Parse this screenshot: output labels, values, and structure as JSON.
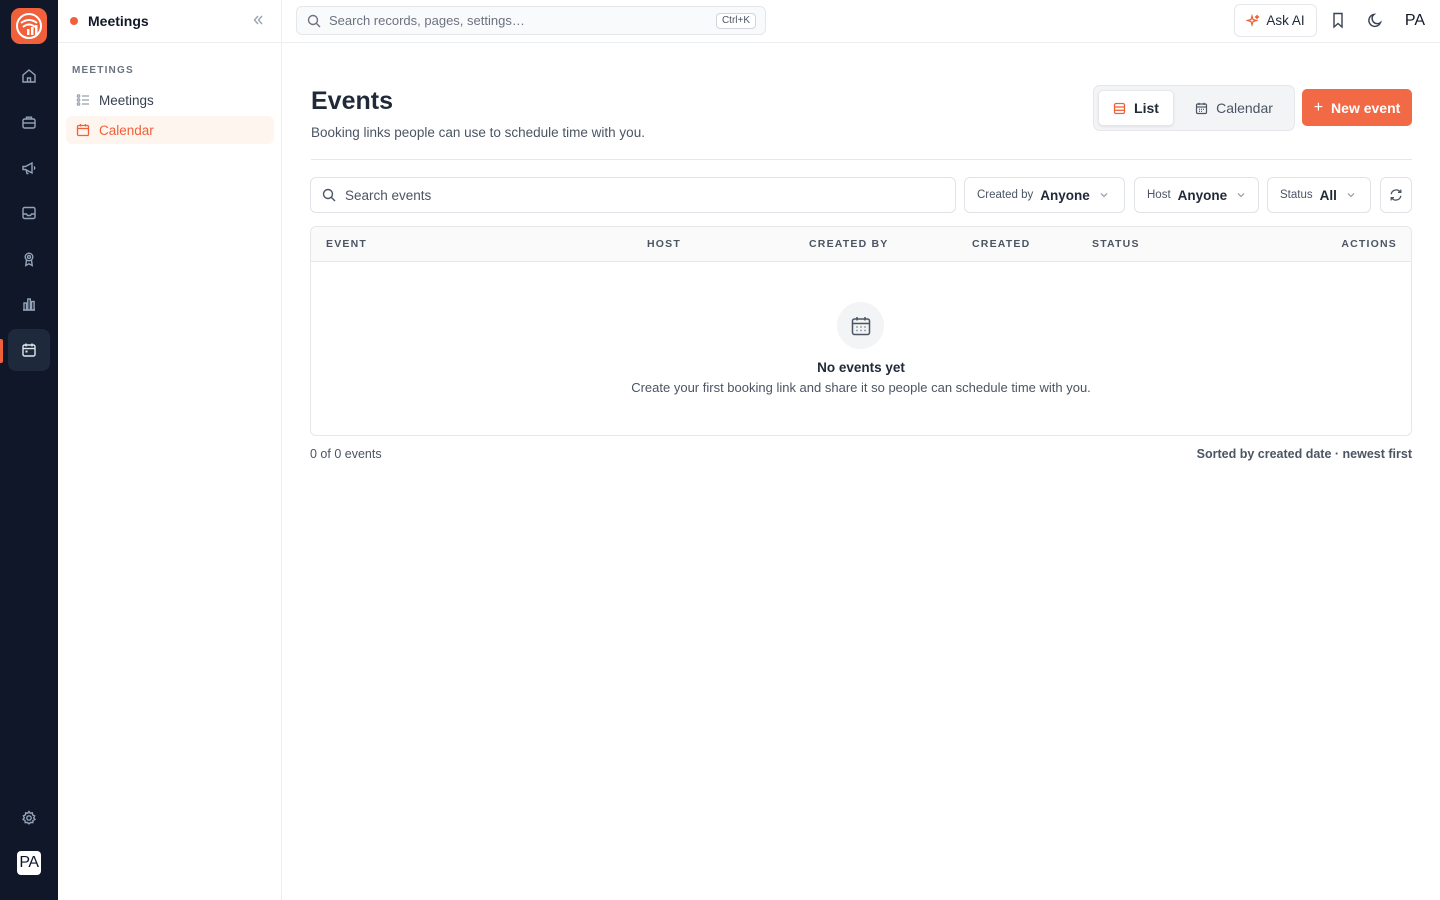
{
  "app": {
    "avatar_initials": "PA"
  },
  "rail": {
    "items": [
      {
        "icon": "home-icon"
      },
      {
        "icon": "briefcase-icon"
      },
      {
        "icon": "megaphone-icon"
      },
      {
        "icon": "inbox-icon"
      },
      {
        "icon": "award-icon"
      },
      {
        "icon": "bar-chart-icon"
      },
      {
        "icon": "calendar-icon",
        "active": true
      }
    ],
    "bottom": [
      {
        "icon": "gear-icon"
      }
    ],
    "accent": "#f0603a",
    "background": "#0f1729"
  },
  "sidebar": {
    "title": "Meetings",
    "section_label": "MEETINGS",
    "items": [
      {
        "label": "Meetings",
        "icon": "list-icon",
        "active": false
      },
      {
        "label": "Calendar",
        "icon": "calendar-icon",
        "active": true
      }
    ]
  },
  "topbar": {
    "search_placeholder": "Search records, pages, settings…",
    "shortcut": "Ctrl+K",
    "ask_ai_label": "Ask AI",
    "avatar_initials": "PA"
  },
  "page": {
    "title": "Events",
    "subtitle": "Booking links people can use to schedule time with you.",
    "view_toggle": {
      "list_label": "List",
      "calendar_label": "Calendar",
      "selected": "List"
    },
    "new_button_label": "New event"
  },
  "filters": {
    "search_placeholder": "Search events",
    "created_by": {
      "label": "Created by",
      "value": "Anyone"
    },
    "host": {
      "label": "Host",
      "value": "Anyone"
    },
    "status": {
      "label": "Status",
      "value": "All"
    }
  },
  "table": {
    "columns": [
      "EVENT",
      "HOST",
      "CREATED BY",
      "CREATED",
      "STATUS",
      "ACTIONS"
    ],
    "rows": [],
    "empty_title": "No events yet",
    "empty_description": "Create your first booking link and share it so people can schedule time with you."
  },
  "footer": {
    "count_text": "0 of 0 events",
    "sort_text": "Sorted by created date · newest first"
  }
}
